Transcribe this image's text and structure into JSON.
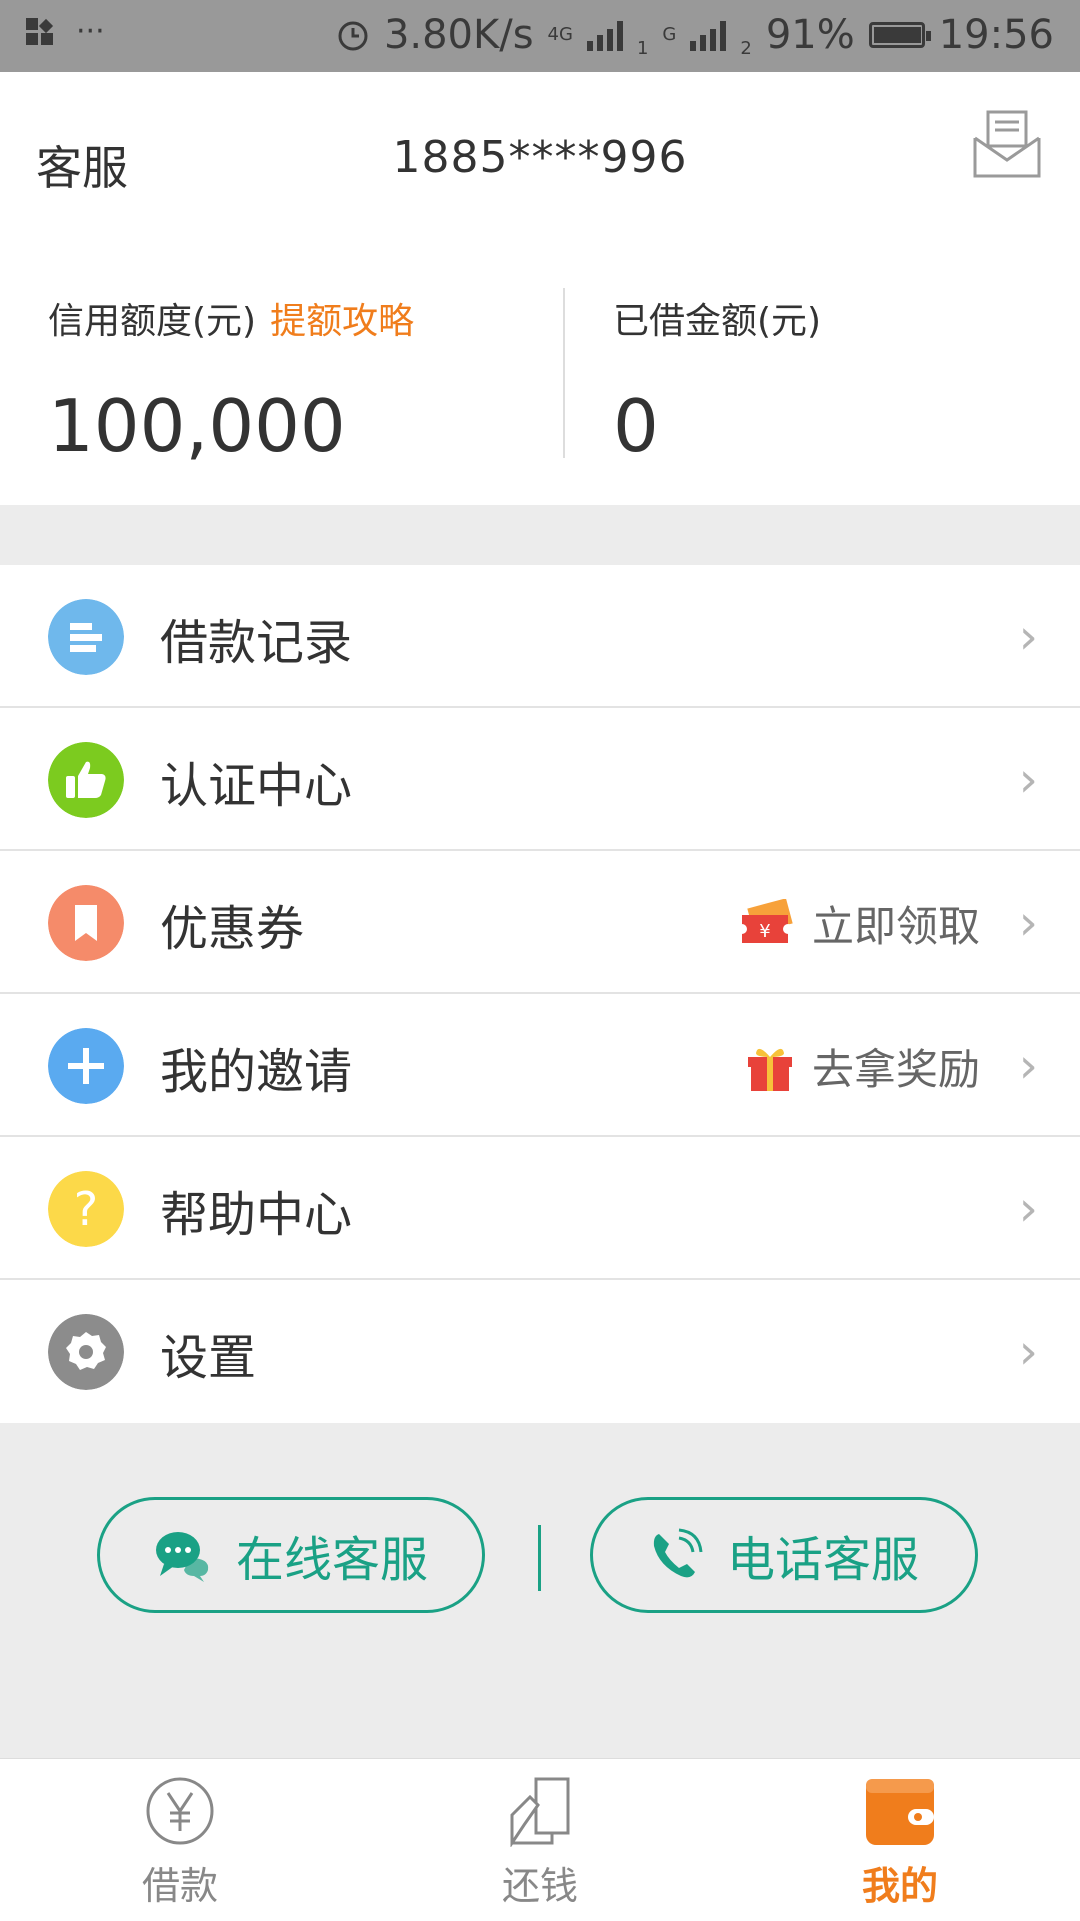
{
  "status_bar": {
    "more": "···",
    "net_speed": "3.80K/s",
    "net_type_1": "4G",
    "sim1": "1",
    "net_type_2": "G",
    "sim2": "2",
    "battery": "91%",
    "time": "19:56"
  },
  "header": {
    "left_label": "客服",
    "phone": "1885****996"
  },
  "credit": {
    "limit_label": "信用额度(元)",
    "limit_link": "提额攻略",
    "limit_value": "100,000",
    "borrowed_label": "已借金额(元)",
    "borrowed_value": "0"
  },
  "menu": [
    {
      "label": "借款记录",
      "icon": "list-icon",
      "color": "#6fb8ec"
    },
    {
      "label": "认证中心",
      "icon": "thumbs-up-icon",
      "color": "#7ccb1f"
    },
    {
      "label": "优惠券",
      "icon": "bookmark-icon",
      "color": "#f58b6a",
      "extra": "立即领取",
      "extra_icon": "coupon-icon"
    },
    {
      "label": "我的邀请",
      "icon": "plus-icon",
      "color": "#5aaaf0",
      "extra": "去拿奖励",
      "extra_icon": "gift-icon"
    },
    {
      "label": "帮助中心",
      "icon": "question-icon",
      "color": "#fcd949"
    },
    {
      "label": "设置",
      "icon": "gear-icon",
      "color": "#8c8c8c"
    }
  ],
  "chevron": "›",
  "service": {
    "online": "在线客服",
    "phone": "电话客服"
  },
  "tabs": [
    {
      "label": "借款",
      "icon": "yen-icon"
    },
    {
      "label": "还钱",
      "icon": "repay-icon"
    },
    {
      "label": "我的",
      "icon": "wallet-icon"
    }
  ],
  "colors": {
    "accent": "#f07d1c",
    "teal": "#1aa185"
  }
}
